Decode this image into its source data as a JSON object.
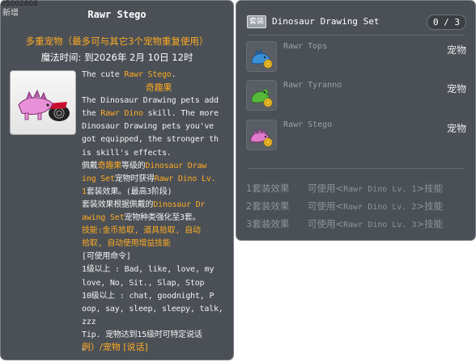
{
  "window": {
    "id_label": "05002808",
    "new_label": "新增"
  },
  "item": {
    "name": "Rawr Stego",
    "type_line": "多重宠物（最多可与其它3个宠物重复使用）",
    "expire_label": "魔法时间: 到2026年 2月 10日 12时"
  },
  "desc": {
    "l1a": "The cute ",
    "l1b": "Rawr Stego",
    "l1c": ".",
    "l2": "奇趣果",
    "l3": "The Dinosaur Drawing pets add",
    "l4a": "the ",
    "l4b": "Rawr Dino",
    "l4c": " skill. The more",
    "l5": "Dinosaur Drawing pets you've",
    "l6": "got equipped, the stronger th",
    "l7": "is skill's effects.",
    "l8a": "佩戴",
    "l8b": "奇趣果",
    "l8c": "等级的",
    "l8d": "Dinosaur Draw",
    "l9a": "ing Set",
    "l9b": "宠物时获得",
    "l9c": "Rawr Dino Lv.",
    "l10a": "1",
    "l10b": "套装效果。(最高3阶段)",
    "l11a": "套装效果根据佩戴的",
    "l11b": "Dinosaur Dr",
    "l12a": "awing Set",
    "l12b": "宠物种类强化至3套。",
    "l13": "技能:金币拾取, 道具拾取, 自动",
    "l14": "拾取, 自动使用增益技能",
    "l15": "[可使用命令]",
    "l16": "1级以上 : Bad, like, love, my",
    "l17": "love, No, Sit., Slap, Stop",
    "l18": "10级以上 : chat, goodnight, P",
    "l19": "oop, say, sleep, sleepy, talk,",
    "l20": "zzz",
    "l21": "Tip. 宠物达到15级时可特定说话",
    "l22": "。",
    "footer": "例）/宠物 [说话]"
  },
  "set": {
    "badge": "套装",
    "title": "Dinosaur Drawing Set",
    "count": "0 / 3",
    "items": [
      {
        "name": "Rawr Tops",
        "type": "宠物",
        "color": "#3a8fd6"
      },
      {
        "name": "Rawr Tyranno",
        "type": "宠物",
        "color": "#57b83a"
      },
      {
        "name": "Rawr Stego",
        "type": "宠物",
        "color": "#e07acb"
      }
    ],
    "effects": [
      {
        "label": "1套装效果",
        "prefix": "可使用<",
        "skill": "Rawr Dino Lv. 1",
        "suffix": ">技能"
      },
      {
        "label": "2套装效果",
        "prefix": "可使用<",
        "skill": "Rawr Dino Lv. 2",
        "suffix": ">技能"
      },
      {
        "label": "3套装效果",
        "prefix": "可使用<",
        "skill": "Rawr Dino Lv. 3",
        "suffix": ">技能"
      }
    ]
  },
  "colors": {
    "accent": "#ffaa22",
    "panel": "#4a5056",
    "muted": "#8e9499"
  }
}
